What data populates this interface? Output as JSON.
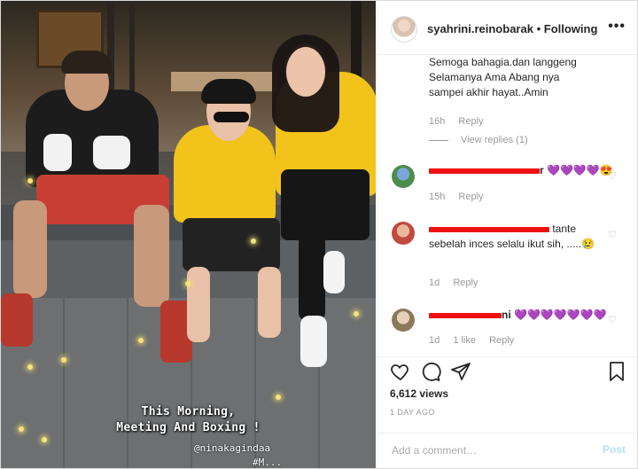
{
  "post": {
    "caption_line1": "This Morning,",
    "caption_line2": "Meeting And Boxing !",
    "mention": "@ninakagindaa",
    "mention_partial": "#M..."
  },
  "header": {
    "username": "syahrini.reinobarak",
    "separator": "•",
    "follow_label": "Following",
    "more_icon": "more-horizontal-icon"
  },
  "comments": [
    {
      "text_line1": "Semoga bahagia.dan langgeng",
      "text_line2": "Selamanya Ama Abang nya",
      "text_line3": "sampei akhir hayat..Amin",
      "age": "16h",
      "reply_label": "Reply",
      "view_replies": "View replies (1)"
    },
    {
      "username_suffix": "r",
      "text": "💜💜💜💜😍",
      "age": "15h",
      "reply_label": "Reply"
    },
    {
      "text_line1": "tante",
      "text_line2": "sebelah inces selalu ikut sih, .....😢",
      "age": "1d",
      "reply_label": "Reply"
    },
    {
      "username_suffix": "ni",
      "text": "💜💜💜💜💜💜💜",
      "age": "1d",
      "likes": "1 like",
      "reply_label": "Reply"
    }
  ],
  "actions": {
    "views": "6,612 views",
    "date": "1 DAY AGO",
    "add_comment_placeholder": "Add a comment…",
    "post_label": "Post"
  },
  "colors": {
    "link_blue": "#b2dffc",
    "meta_gray": "#999999",
    "redaction": "#ee1111",
    "hoodie_yellow": "#f2c31a"
  }
}
